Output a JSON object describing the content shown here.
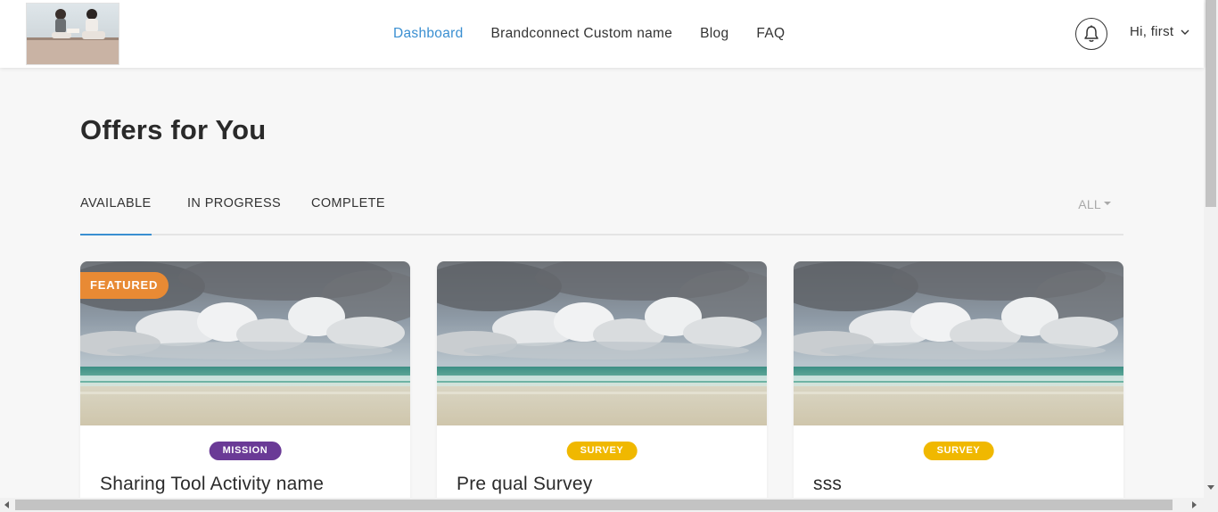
{
  "header": {
    "logo_alt": "",
    "nav": [
      {
        "label": "Dashboard",
        "active": true
      },
      {
        "label": "Brandconnect Custom name",
        "active": false
      },
      {
        "label": "Blog",
        "active": false
      },
      {
        "label": "FAQ",
        "active": false
      }
    ],
    "notification_icon": "bell-icon",
    "user_greeting": "Hi, first",
    "user_menu_icon": "chevron-down-icon"
  },
  "main": {
    "title": "Offers for You",
    "tabs": [
      {
        "label": "AVAILABLE",
        "active": true
      },
      {
        "label": "IN PROGRESS",
        "active": false
      },
      {
        "label": "COMPLETE",
        "active": false
      }
    ],
    "filter": {
      "label": "ALL",
      "icon": "caret-down-icon"
    }
  },
  "offers": [
    {
      "featured_label": "FEATURED",
      "type": "MISSION",
      "type_color": "#6a3a96",
      "title": "Sharing Tool Activity name"
    },
    {
      "featured_label": "",
      "type": "SURVEY",
      "type_color": "#f0b800",
      "title": "Pre qual Survey"
    },
    {
      "featured_label": "",
      "type": "SURVEY",
      "type_color": "#f0b800",
      "title": "sss"
    }
  ],
  "colors": {
    "accent": "#3a8fd1",
    "featured": "#e88a34",
    "mission": "#6a3a96",
    "survey": "#f0b800"
  }
}
